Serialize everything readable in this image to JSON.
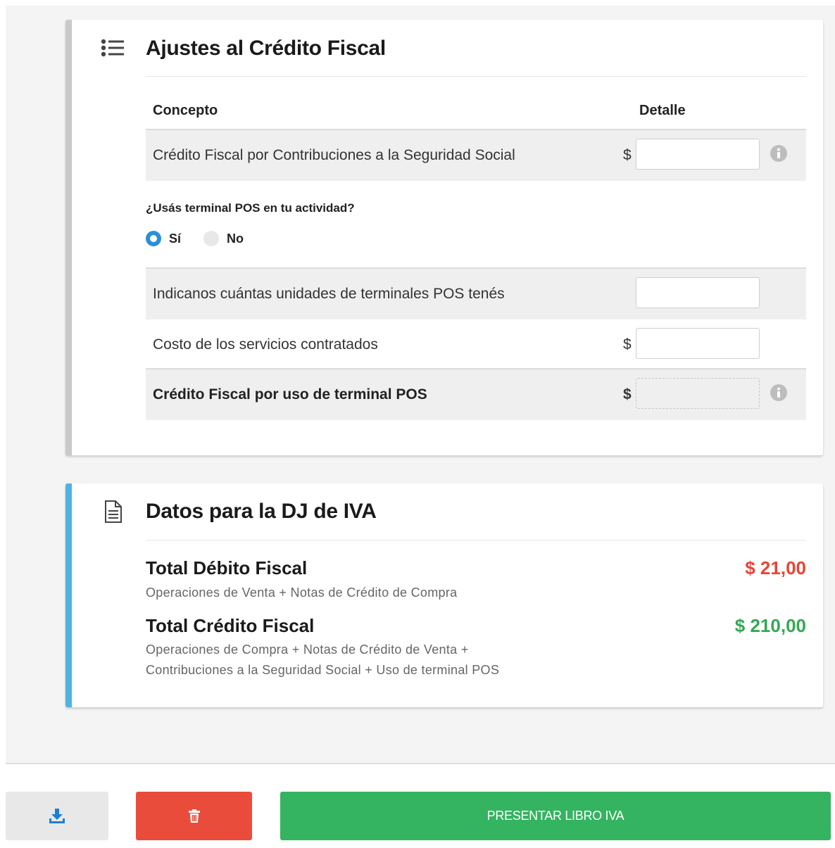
{
  "ajustes": {
    "title": "Ajustes al Crédito Fiscal",
    "icon": "list-icon",
    "headers": {
      "concepto": "Concepto",
      "detalle": "Detalle"
    },
    "row_seguridad": {
      "label": "Crédito Fiscal por Contribuciones a la Seguridad Social",
      "currency": "$",
      "value": ""
    },
    "pos_question": "¿Usás terminal POS en tu actividad?",
    "radio": {
      "yes_label": "Sí",
      "no_label": "No",
      "selected": "yes"
    },
    "row_unidades": {
      "label": "Indicanos cuántas unidades de terminales POS tenés",
      "value": ""
    },
    "row_costo": {
      "label": "Costo de los servicios contratados",
      "currency": "$",
      "value": ""
    },
    "row_credito_pos": {
      "label": "Crédito Fiscal por uso de terminal POS",
      "currency": "$",
      "value": ""
    }
  },
  "dj": {
    "title": "Datos para la DJ de IVA",
    "icon": "document-icon",
    "debito": {
      "label": "Total Débito Fiscal",
      "description": "Operaciones de Venta + Notas de Crédito de Compra",
      "amount": "$ 21,00"
    },
    "credito": {
      "label": "Total Crédito Fiscal",
      "description_line1": "Operaciones de Compra + Notas de Crédito de Venta +",
      "description_line2": "Contribuciones a la Seguridad Social + Uso de terminal POS",
      "amount": "$ 210,00"
    }
  },
  "footer": {
    "download_icon": "download-icon",
    "delete_icon": "trash-icon",
    "submit_label": "PRESENTAR LIBRO IVA"
  },
  "colors": {
    "accent_blue": "#4fb3e0",
    "radio_blue": "#2a8fd6",
    "debit_red": "#ea4335",
    "credit_green": "#34a853",
    "delete_red": "#ea4c3c",
    "submit_green": "#34b360"
  }
}
